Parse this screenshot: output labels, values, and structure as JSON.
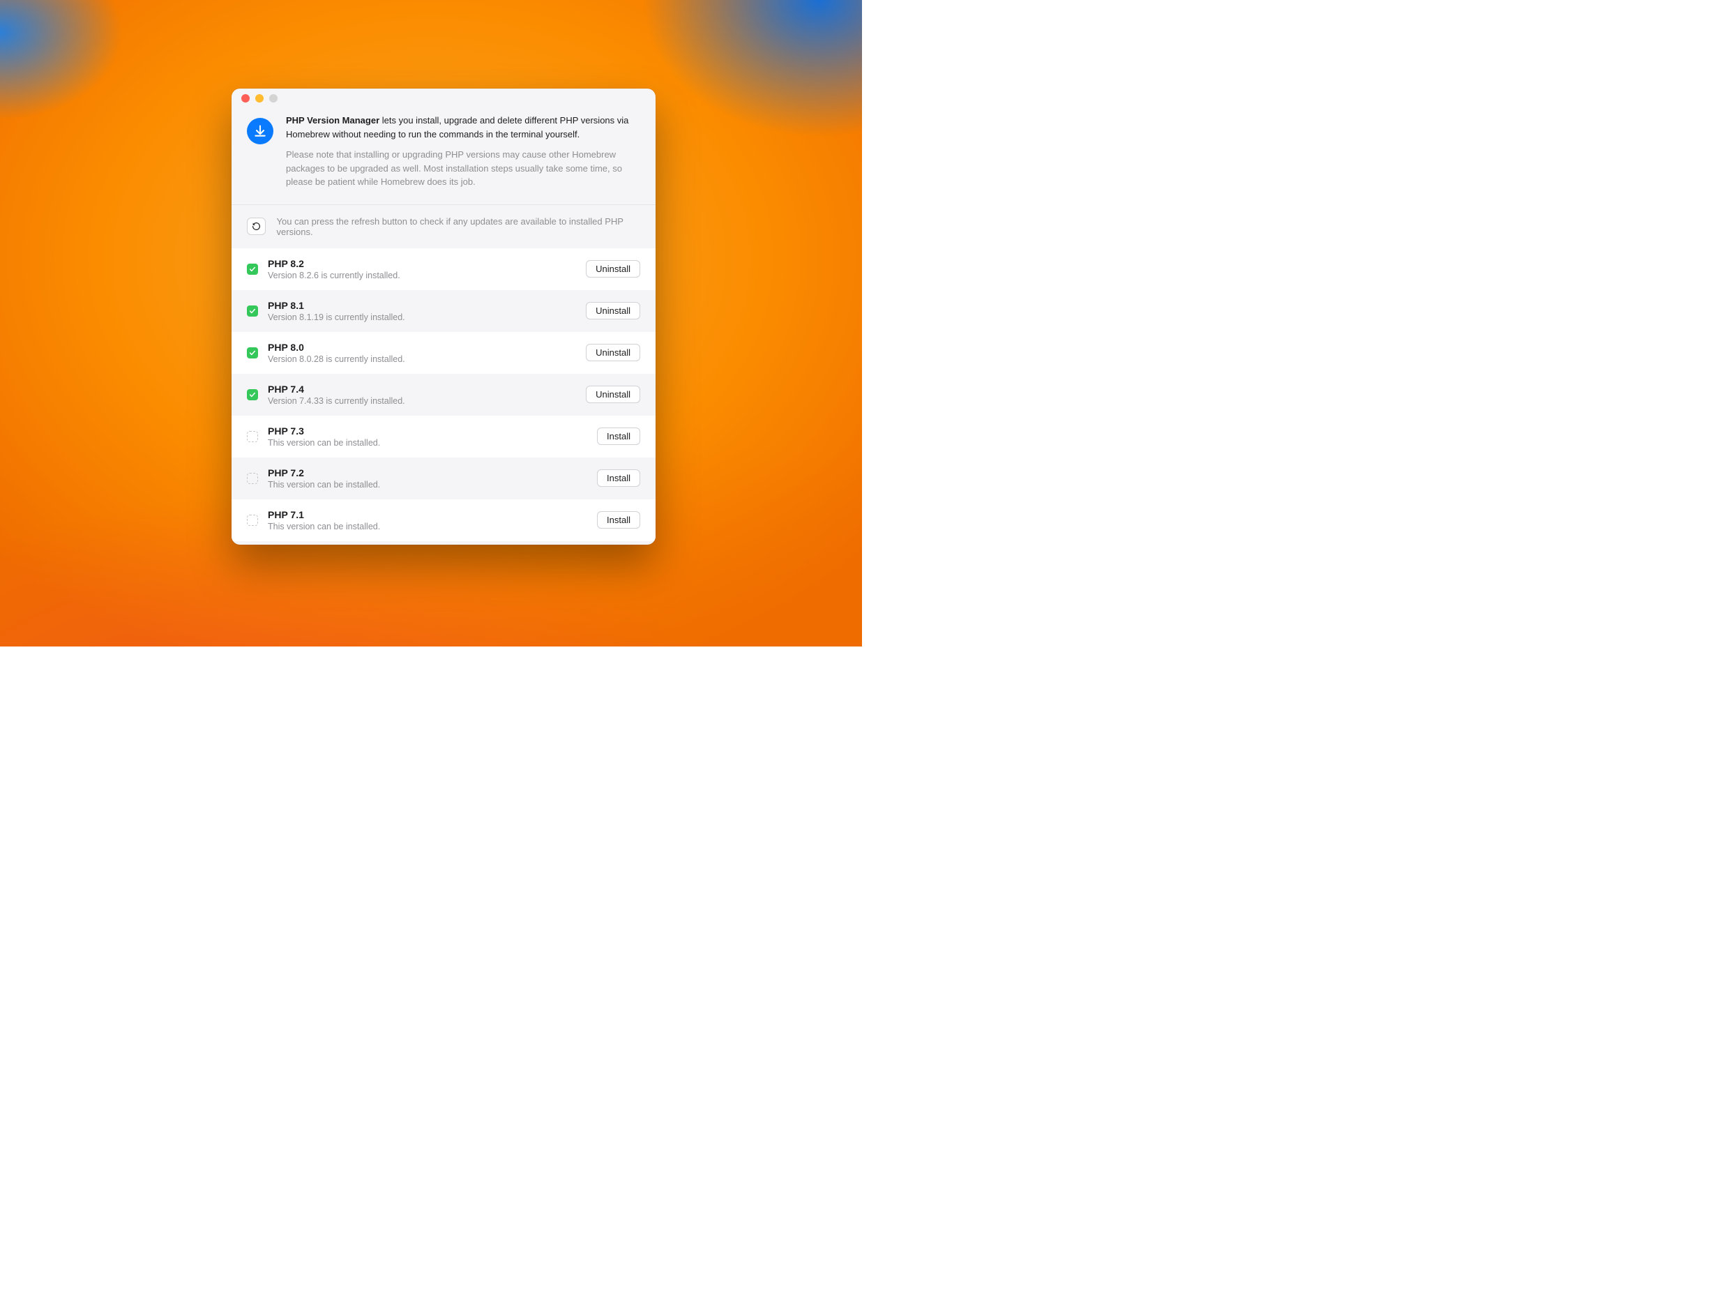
{
  "header": {
    "title_bold": "PHP Version Manager",
    "title_rest": " lets you install, upgrade and delete different PHP versions via Homebrew without needing to run the commands in the terminal yourself.",
    "note": "Please note that installing or upgrading PHP versions may cause other Homebrew packages to be upgraded as well. Most installation steps usually take some time, so please be patient while Homebrew does its job."
  },
  "refresh": {
    "hint": "You can press the refresh button to check if any updates are available to installed PHP versions."
  },
  "buttons": {
    "install": "Install",
    "uninstall": "Uninstall"
  },
  "versions": [
    {
      "title": "PHP 8.2",
      "subtitle": "Version 8.2.6 is currently installed.",
      "installed": true,
      "action": "uninstall"
    },
    {
      "title": "PHP 8.1",
      "subtitle": "Version 8.1.19 is currently installed.",
      "installed": true,
      "action": "uninstall"
    },
    {
      "title": "PHP 8.0",
      "subtitle": "Version 8.0.28 is currently installed.",
      "installed": true,
      "action": "uninstall"
    },
    {
      "title": "PHP 7.4",
      "subtitle": "Version 7.4.33 is currently installed.",
      "installed": true,
      "action": "uninstall"
    },
    {
      "title": "PHP 7.3",
      "subtitle": "This version can be installed.",
      "installed": false,
      "action": "install"
    },
    {
      "title": "PHP 7.2",
      "subtitle": "This version can be installed.",
      "installed": false,
      "action": "install"
    },
    {
      "title": "PHP 7.1",
      "subtitle": "This version can be installed.",
      "installed": false,
      "action": "install"
    }
  ]
}
